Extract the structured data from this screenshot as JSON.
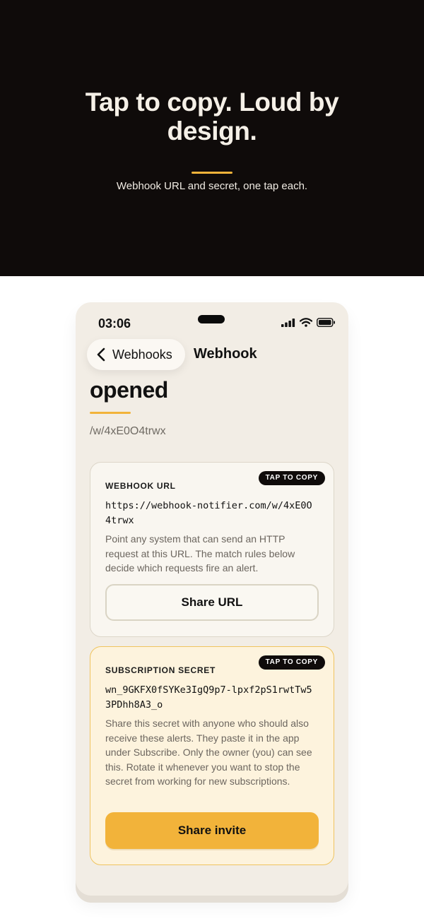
{
  "hero": {
    "title": "Tap to copy. Loud by design.",
    "subtitle": "Webhook URL and secret, one tap each."
  },
  "status_bar": {
    "time": "03:06"
  },
  "nav": {
    "back_label": "Webhooks",
    "title_line1": "Webhook",
    "title_line2": "opened"
  },
  "path": "/w/4xE0O4trwx",
  "url_card": {
    "chip": "TAP TO COPY",
    "label": "WEBHOOK URL",
    "value": "https://webhook-notifier.com/w/4xE0O4trwx",
    "description": "Point any system that can send an HTTP request at this URL. The match rules below decide which requests fire an alert.",
    "button": "Share URL"
  },
  "secret_card": {
    "chip": "TAP TO COPY",
    "label": "SUBSCRIPTION SECRET",
    "value": "wn_9GKFX0fSYKe3IgQ9p7-lpxf2pS1rwtTw53PDhh8A3_o",
    "description": "Share this secret with anyone who should also receive these alerts. They paste it in the app under Subscribe. Only the owner (you) can see this. Rotate it whenever you want to stop the secret from working for new subscriptions.",
    "button": "Share invite"
  },
  "colors": {
    "accent": "#f2b33a",
    "dark": "#0f0b0a",
    "phone_bg": "#f2ede5"
  }
}
